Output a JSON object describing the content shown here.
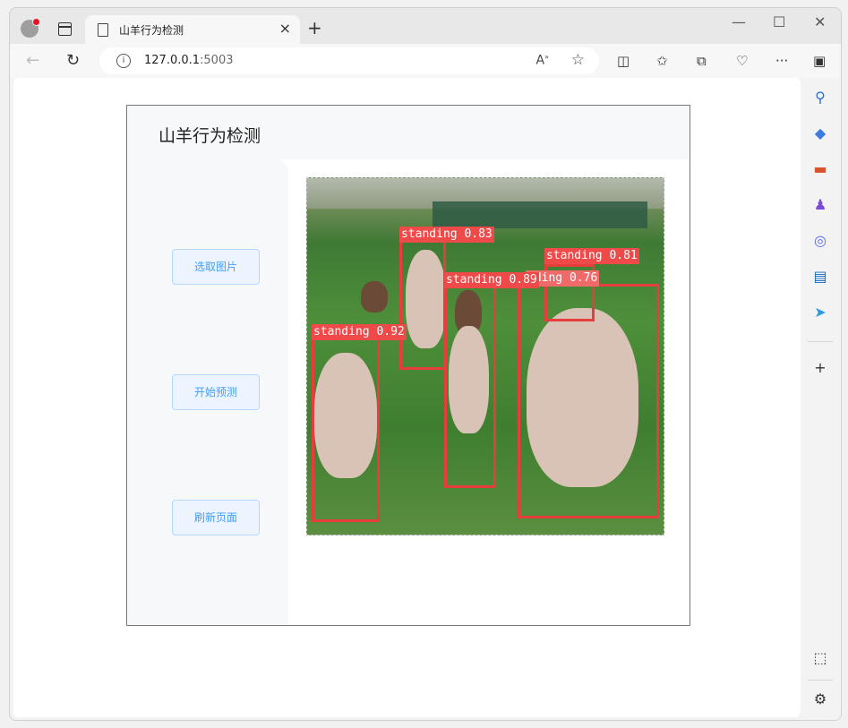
{
  "browser": {
    "tab_title": "山羊行为检测",
    "new_tab_label": "+",
    "url_host": "127.0.0.1",
    "url_port": ":5003",
    "window_controls": {
      "minimize": "—",
      "maximize": "☐",
      "close": "✕"
    }
  },
  "app": {
    "title": "山羊行为检测",
    "buttons": {
      "select_image": "选取图片",
      "start_predict": "开始预测",
      "refresh_page": "刷新页面"
    }
  },
  "detections": [
    {
      "label": "standing 0.83"
    },
    {
      "label": "standing 0.81"
    },
    {
      "label": "standing 0.89"
    },
    {
      "label": "nding 0.76"
    },
    {
      "label": "standing 0.92"
    }
  ],
  "colors": {
    "accent": "#409eff",
    "button_bg": "#ecf5ff",
    "bbox": "#e73d3d"
  }
}
